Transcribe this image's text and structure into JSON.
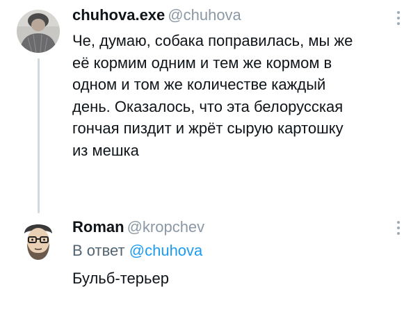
{
  "tweets": [
    {
      "display_name": "chuhova.exe",
      "handle": "@chuhova",
      "lines": [
        "Че, думаю, собака поправилась, мы же",
        "её кормим одним и тем же кормом в",
        "одном и том же количестве каждый",
        "день. Оказалось, что эта белорусская",
        "гончая пиздит и жрёт сырую картошку",
        "из мешка"
      ],
      "avatar_icon": "profile-photo"
    },
    {
      "display_name": "Roman",
      "handle": "@kropchev",
      "reply_prefix": "В ответ",
      "reply_mention": "@chuhova",
      "text": "Бульб-терьер",
      "avatar_icon": "profile-photo"
    }
  ],
  "colors": {
    "text": "#0f1419",
    "secondary": "#536471",
    "handle": "#8b98a5",
    "link": "#1d9bf0",
    "thread_line": "#cfd9de"
  }
}
